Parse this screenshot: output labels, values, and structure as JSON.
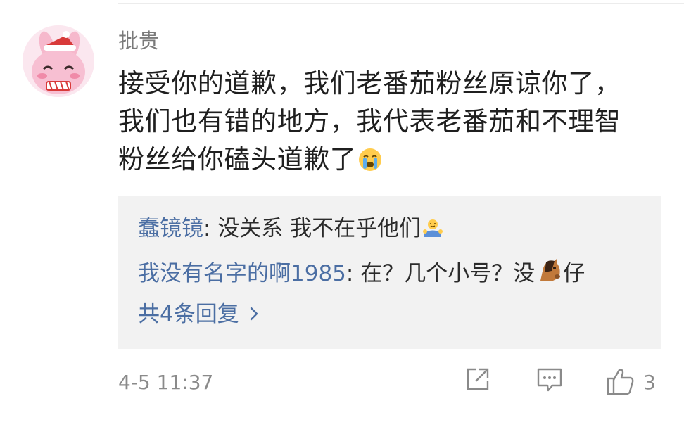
{
  "comment": {
    "username": "批贵",
    "content_lines": [
      "接受你的道歉，我们老番茄粉丝原谅你了，",
      "我们也有错的地方，我代表老番茄和不理智",
      "粉丝给你磕头道歉了"
    ],
    "content_emoji": "crying-face",
    "time": "4-5 11:37",
    "like_count": "3"
  },
  "replies": [
    {
      "author": "蠢镜镜",
      "separator": ": ",
      "text": "没关系 我不在乎他们",
      "emoji": "shrug-person"
    },
    {
      "author": "我没有名字的啊1985",
      "separator": ": ",
      "text_before": "在？几个小号？没",
      "emoji": "horse-face",
      "text_after": "仔"
    }
  ],
  "more_replies": {
    "label": "共4条回复",
    "icon": "chevron-right-icon"
  },
  "actions": {
    "share_icon": "share-icon",
    "comment_icon": "comment-icon",
    "like_icon": "thumbs-up-icon"
  },
  "colors": {
    "link": "#4b6ea3",
    "meta": "#8a8a8a",
    "reply_bg": "#f2f2f2",
    "avatar_bg": "#fbe7ef"
  }
}
